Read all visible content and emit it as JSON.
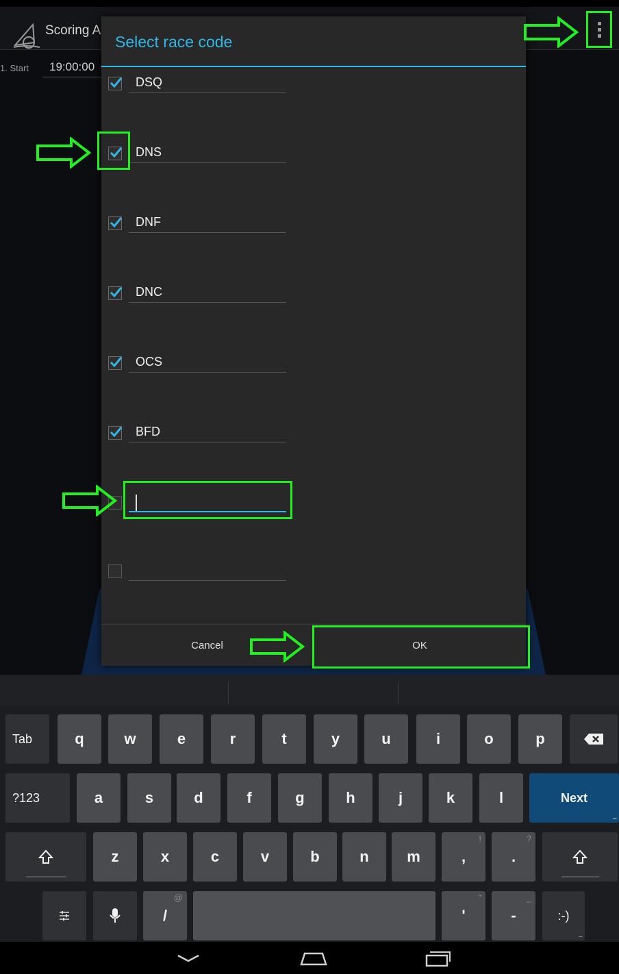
{
  "app": {
    "title": "Scoring A",
    "start_label": "1. Start",
    "start_time": "19:00:00"
  },
  "dialog": {
    "title": "Select race code",
    "codes": [
      {
        "label": "DSQ",
        "checked": true
      },
      {
        "label": "DNS",
        "checked": true
      },
      {
        "label": "DNF",
        "checked": true
      },
      {
        "label": "DNC",
        "checked": true
      },
      {
        "label": "OCS",
        "checked": true
      },
      {
        "label": "BFD",
        "checked": true
      },
      {
        "label": "",
        "checked": false
      },
      {
        "label": "",
        "checked": false
      }
    ],
    "cancel_label": "Cancel",
    "ok_label": "OK"
  },
  "keyboard": {
    "row1": [
      "Tab",
      "q",
      "w",
      "e",
      "r",
      "t",
      "y",
      "u",
      "i",
      "o",
      "p"
    ],
    "row2": [
      "?123",
      "a",
      "s",
      "d",
      "f",
      "g",
      "h",
      "j",
      "k",
      "l",
      "Next"
    ],
    "row3": [
      "z",
      "x",
      "c",
      "v",
      "b",
      "n",
      "m",
      ",",
      "."
    ],
    "row3_hints": [
      "!",
      "?"
    ],
    "row4": [
      "/",
      "'",
      "-",
      ":-)"
    ],
    "row4_hints": [
      "@",
      "\"",
      "_"
    ],
    "icons": [
      "backspace-icon",
      "shift-icon",
      "settings-icon",
      "mic-icon"
    ]
  },
  "navbar": {
    "icons": [
      "back-icon",
      "home-icon",
      "recents-icon"
    ]
  },
  "colors": {
    "accent": "#33b5e5",
    "highlight": "#22ee22",
    "next_key": "#0f4a78"
  }
}
